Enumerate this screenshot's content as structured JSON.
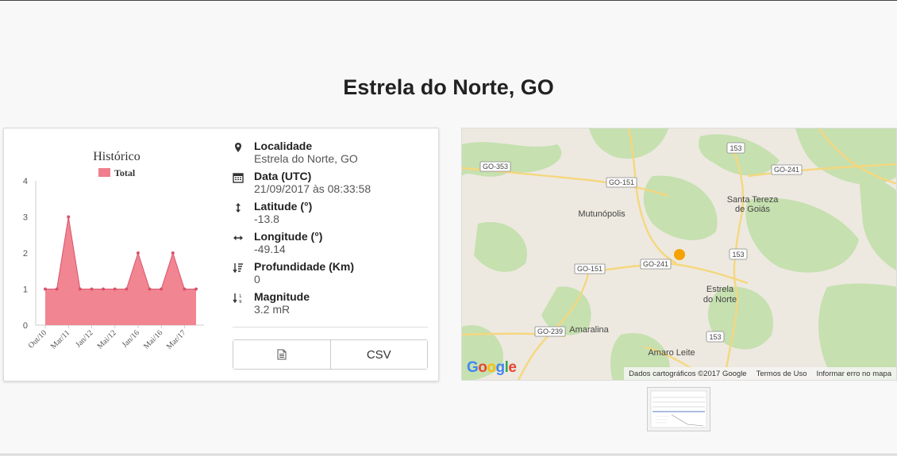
{
  "page": {
    "title": "Estrela do Norte, GO"
  },
  "chart_data": {
    "type": "area",
    "title": "Histórico",
    "series": [
      {
        "name": "Total",
        "values": [
          1,
          1,
          3,
          1,
          1,
          1,
          1,
          1,
          2,
          1,
          1,
          2,
          1,
          1
        ]
      }
    ],
    "x_tick_labels": [
      "Out/10",
      "Mar/11",
      "Jan/12",
      "Mai/12",
      "Jan/16",
      "Mai/16",
      "Mar/17"
    ],
    "ylim": [
      0,
      4
    ],
    "y_ticks": [
      0,
      1,
      2,
      3,
      4
    ],
    "legend": "top",
    "color": "#f07e8c",
    "line_color": "#d8546a"
  },
  "info": {
    "location": {
      "label": "Localidade",
      "value": "Estrela do Norte, GO"
    },
    "date": {
      "label": "Data (UTC)",
      "value": "21/09/2017 às 08:33:58"
    },
    "latitude": {
      "label": "Latitude (°)",
      "value": "-13.8"
    },
    "longitude": {
      "label": "Longitude (°)",
      "value": "-49.14"
    },
    "depth": {
      "label": "Profundidade (Km)",
      "value": "0"
    },
    "magnitude": {
      "label": "Magnitude",
      "value": "3.2 mR"
    }
  },
  "buttons": {
    "csv_label": "CSV",
    "doc_icon": "document-icon"
  },
  "map": {
    "places": [
      "Mutunópolis",
      "Santa Tereza",
      "de Goiás",
      "Estrela",
      "do Norte",
      "Amaralina",
      "Amaro Leite"
    ],
    "roads": [
      "GO-353",
      "GO-151",
      "GO-241",
      "153",
      "GO-151",
      "GO-241",
      "153",
      "GO-239",
      "153"
    ],
    "logo": "Google",
    "footer": {
      "data": "Dados cartográficos ©2017 Google",
      "terms": "Termos de Uso",
      "report": "Informar erro no mapa"
    },
    "marker_color": "#f4a300"
  }
}
